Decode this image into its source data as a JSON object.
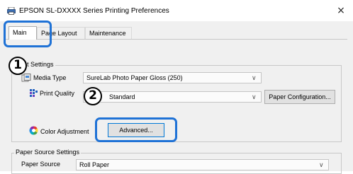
{
  "window": {
    "title": "EPSON SL-DXXXX Series Printing Preferences",
    "close_glyph": "×"
  },
  "tabs": [
    {
      "label": "Main"
    },
    {
      "label": "Page Layout"
    },
    {
      "label": "Maintenance"
    }
  ],
  "callouts": {
    "one": "1",
    "two": "2"
  },
  "print_settings": {
    "group_title": "Print Settings",
    "media_type_label": "Media Type",
    "media_type_value": "SureLab Photo Paper Gloss (250)",
    "print_quality_label": "Print Quality",
    "print_quality_value": "Standard",
    "paper_configuration_button": "Paper Configuration...",
    "color_adjustment_label": "Color Adjustment",
    "advanced_button": "Advanced..."
  },
  "paper_source": {
    "group_title": "Paper Source Settings",
    "paper_source_label": "Paper Source",
    "paper_source_value": "Roll Paper"
  },
  "colors": {
    "highlight": "#1f72d6",
    "dialog_bg": "#f0f0f0"
  }
}
